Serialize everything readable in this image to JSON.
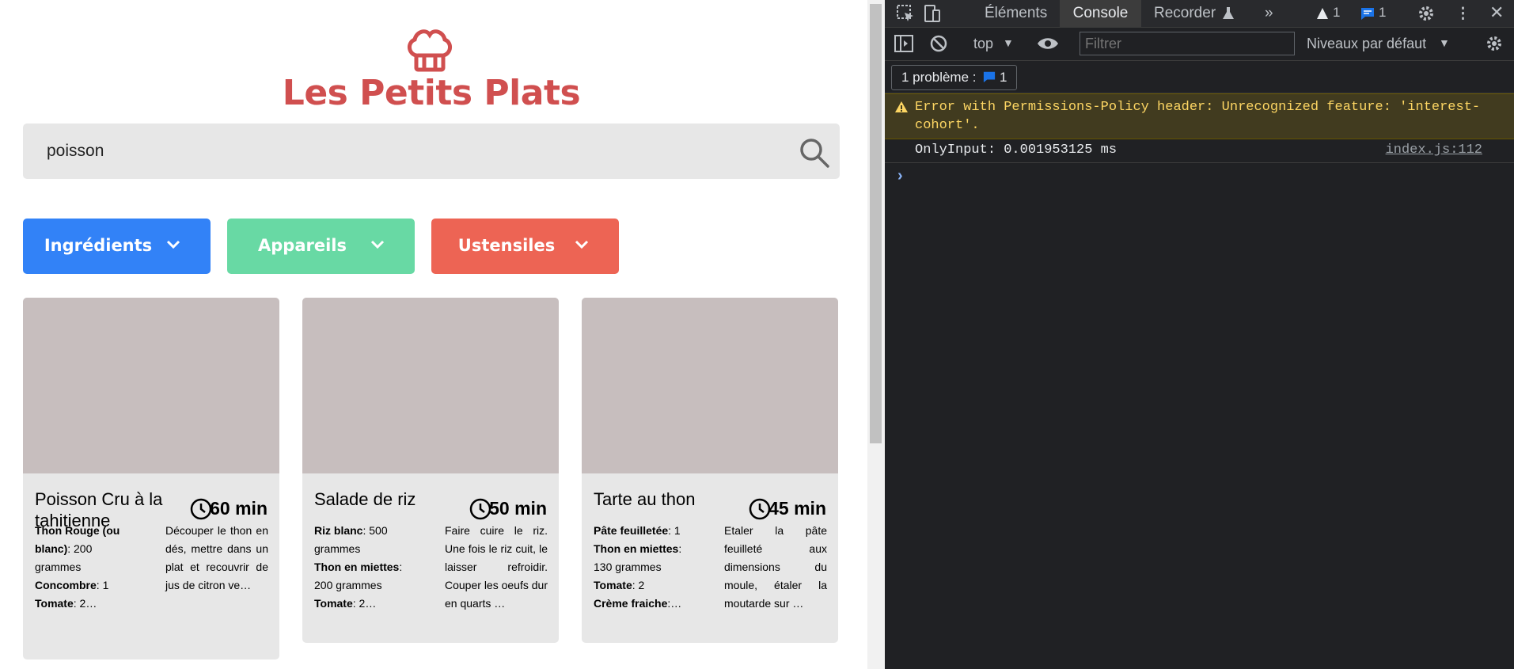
{
  "app": {
    "title": "Les Petits Plats",
    "accent_color": "#d04f4f"
  },
  "search": {
    "value": "poisson",
    "icon": "search-icon"
  },
  "filters": [
    {
      "label": "Ingrédients",
      "color": "#3282f7"
    },
    {
      "label": "Appareils",
      "color": "#68d9a4"
    },
    {
      "label": "Ustensiles",
      "color": "#ed6454"
    }
  ],
  "recipes": [
    {
      "name": "Poisson Cru à la tahitienne",
      "time": "60 min",
      "ingredients_html": "<b>Thon Rouge (ou blanc)</b>: 200 grammes<br><b>Concombre</b>: 1<br><b>Tomate</b>: 2…",
      "description": "Découper le thon en dés, mettre dans un plat et recouvrir de jus de citron ve…"
    },
    {
      "name": "Salade de riz",
      "time": "50 min",
      "ingredients_html": "<b>Riz blanc</b>: 500 grammes<br><b>Thon en miettes</b>: 200 grammes<br><b>Tomate</b>: 2…",
      "description": "Faire cuire le riz. Une fois le riz cuit, le laisser refroidir. Couper les oeufs dur en quarts …"
    },
    {
      "name": "Tarte au thon",
      "time": "45 min",
      "ingredients_html": "<b>Pâte feuilletée</b>: 1<br><b>Thon en miettes</b>: 130 grammes<br><b>Tomate</b>: 2<br><b>Crème fraiche</b>:…",
      "description": "Etaler la pâte feuilleté aux dimensions du moule, étaler la moutarde sur …"
    }
  ],
  "devtools": {
    "tabs": {
      "elements": "Éléments",
      "console": "Console",
      "recorder": "Recorder"
    },
    "warning_count": "1",
    "message_count": "1",
    "toolbar": {
      "context": "top",
      "filter_placeholder": "Filtrer",
      "levels": "Niveaux par défaut"
    },
    "issues": {
      "label": "1 problème :",
      "count": "1"
    },
    "console": {
      "warning": "Error with Permissions-Policy header: Unrecognized feature: 'interest-cohort'.",
      "log": "OnlyInput: 0.001953125 ms",
      "log_source": "index.js:112"
    }
  }
}
